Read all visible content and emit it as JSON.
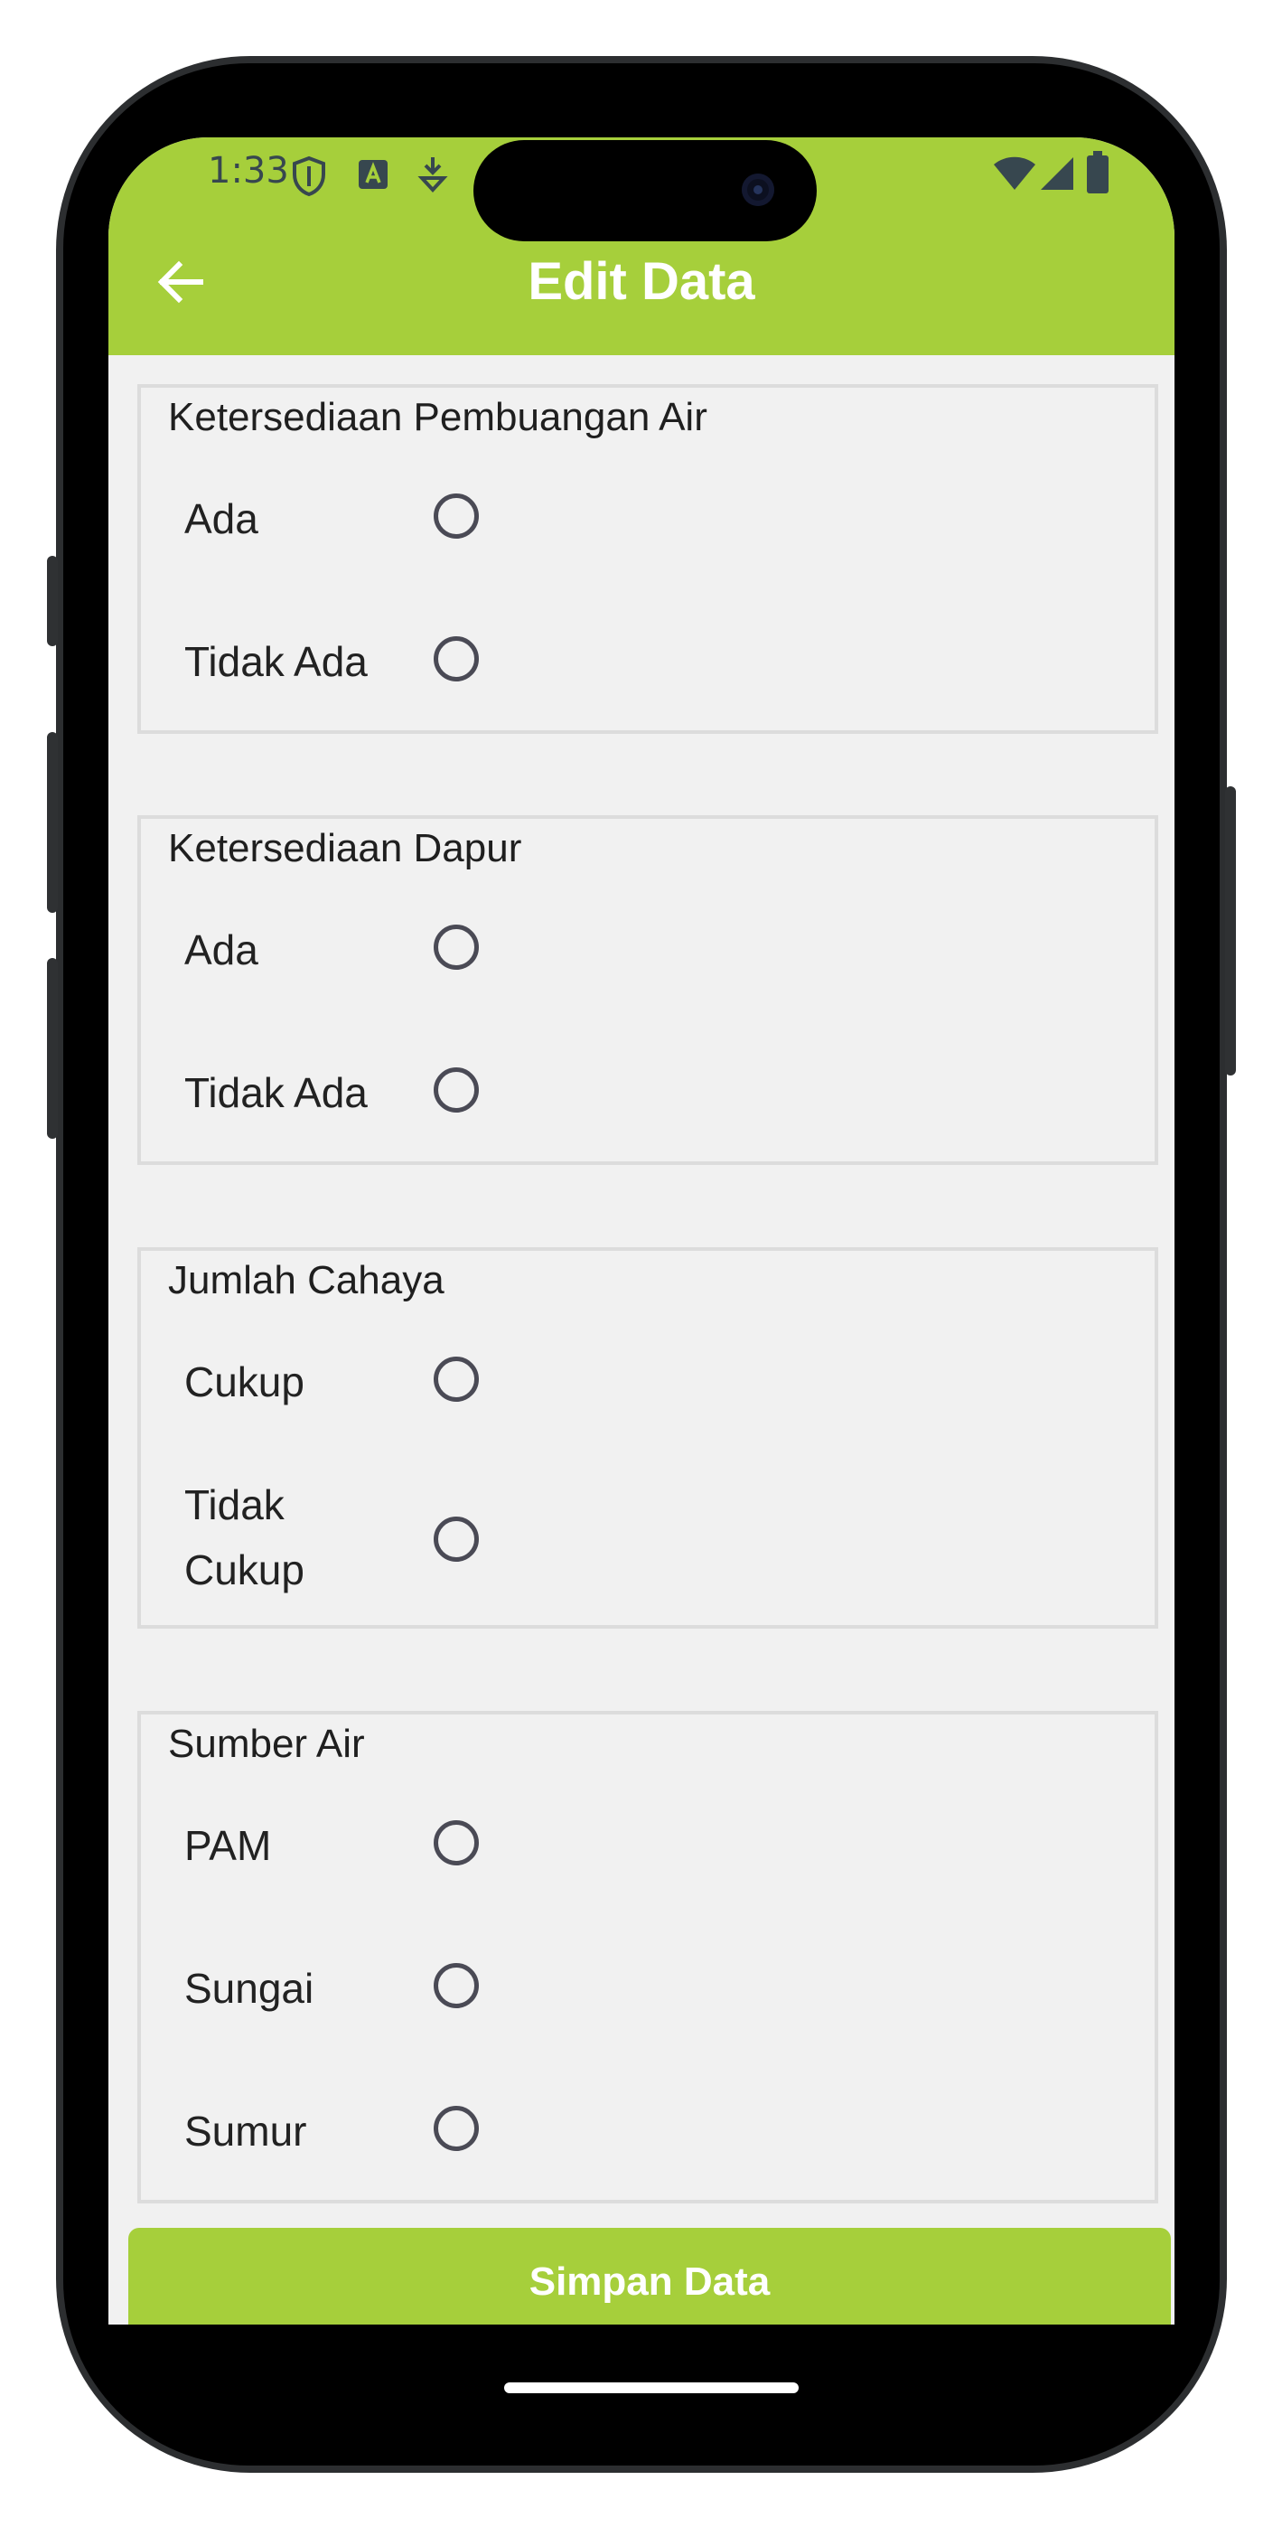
{
  "status_bar": {
    "time": "1:33"
  },
  "header": {
    "title": "Edit Data",
    "back_icon": "arrow-left-icon",
    "background": "#a6cf3b"
  },
  "groups": [
    {
      "title": "Ketersediaan Pembuangan Air",
      "options": [
        {
          "label": "Ada",
          "checked": false
        },
        {
          "label": "Tidak Ada",
          "checked": false
        }
      ]
    },
    {
      "title": "Ketersediaan Dapur",
      "options": [
        {
          "label": "Ada",
          "checked": false
        },
        {
          "label": "Tidak Ada",
          "checked": false
        }
      ]
    },
    {
      "title": "Jumlah Cahaya",
      "options": [
        {
          "label": "Cukup",
          "checked": false
        },
        {
          "label": "Tidak Cukup",
          "checked": false
        }
      ]
    },
    {
      "title": "Sumber Air",
      "options": [
        {
          "label": "PAM",
          "checked": false
        },
        {
          "label": "Sungai",
          "checked": false
        },
        {
          "label": "Sumur",
          "checked": false
        }
      ]
    }
  ],
  "footer": {
    "save_label": "Simpan Data"
  },
  "colors": {
    "accent": "#a6cf3b",
    "background": "#f1f1f1",
    "radio": "#4a4a55"
  }
}
